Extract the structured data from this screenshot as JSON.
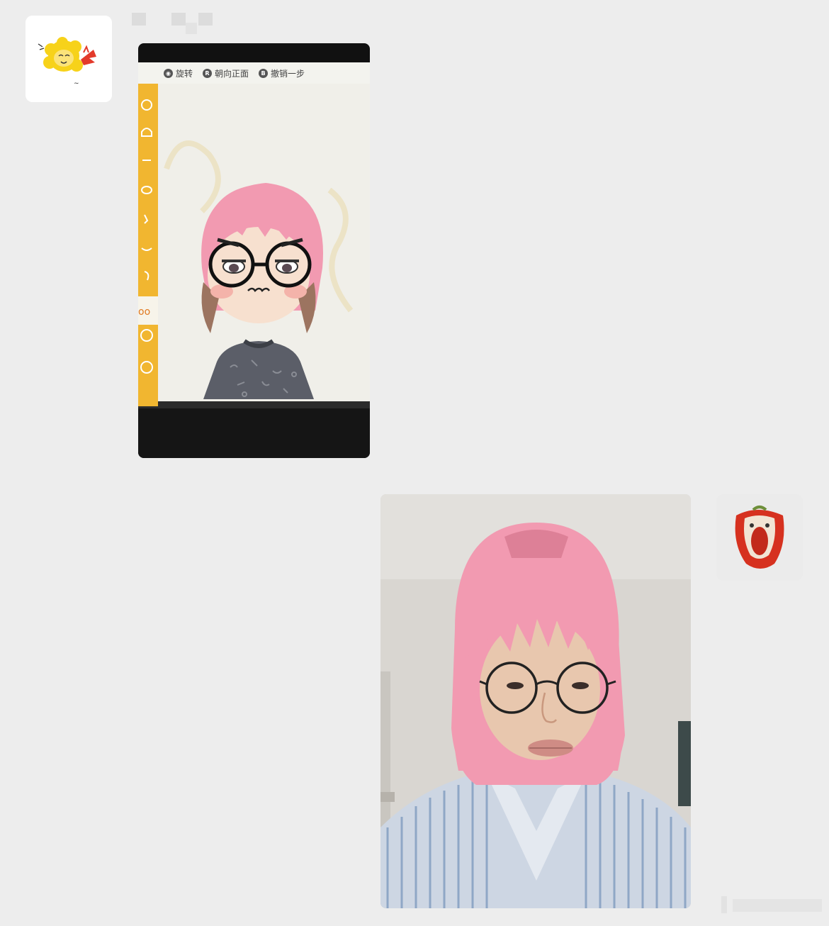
{
  "messages": [
    {
      "side": "left",
      "sender_avatar_icon": "cartoon-lion-sticker-icon",
      "content_type": "image",
      "image_subject": "game-avatar-editor",
      "game_hints": [
        {
          "button_icon": "stick-button-icon",
          "label": "旋转"
        },
        {
          "button_icon": "r-button-icon",
          "label": "朝向正面"
        },
        {
          "button_icon": "b-button-icon",
          "label": "撤销一步"
        }
      ]
    },
    {
      "side": "right",
      "sender_avatar_icon": "red-pepper-face-icon",
      "content_type": "image",
      "image_subject": "selfie-pink-hair"
    }
  ],
  "colors": {
    "background": "#ededed",
    "accent_yellow": "#f1b630",
    "hair_pink": "#f29ab1"
  }
}
